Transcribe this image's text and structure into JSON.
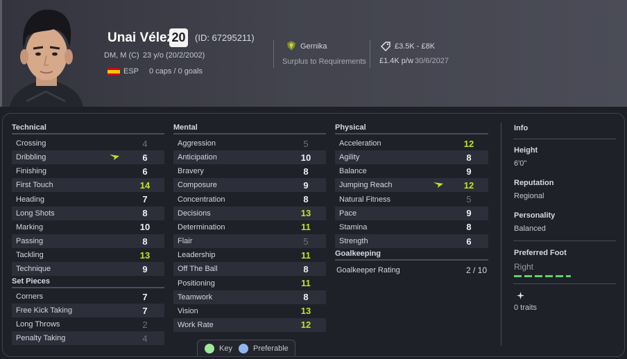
{
  "player": {
    "name": "Unai Vélez",
    "age": "20",
    "id": "(ID: 67295211)",
    "positions": "DM, M (C)",
    "age_dob": "23 y/o (20/2/2002)",
    "nation": "ESP",
    "caps": "0 caps / 0 goals"
  },
  "club": {
    "name": "Gernika",
    "status": "Surplus to Requirements"
  },
  "contract": {
    "value": "£3.5K - £8K",
    "wage": "£1.4K p/w",
    "expiry": "30/6/2027"
  },
  "sections": {
    "technical": "Technical",
    "set_pieces": "Set Pieces",
    "mental": "Mental",
    "physical": "Physical",
    "goalkeeping": "Goalkeeping"
  },
  "technical": [
    {
      "label": "Crossing",
      "value": "4"
    },
    {
      "label": "Dribbling",
      "value": "6"
    },
    {
      "label": "Finishing",
      "value": "6"
    },
    {
      "label": "First Touch",
      "value": "14"
    },
    {
      "label": "Heading",
      "value": "7"
    },
    {
      "label": "Long Shots",
      "value": "8"
    },
    {
      "label": "Marking",
      "value": "10"
    },
    {
      "label": "Passing",
      "value": "8"
    },
    {
      "label": "Tackling",
      "value": "13"
    },
    {
      "label": "Technique",
      "value": "9"
    }
  ],
  "set_pieces": [
    {
      "label": "Corners",
      "value": "7"
    },
    {
      "label": "Free Kick Taking",
      "value": "7"
    },
    {
      "label": "Long Throws",
      "value": "2"
    },
    {
      "label": "Penalty Taking",
      "value": "4"
    }
  ],
  "mental": [
    {
      "label": "Aggression",
      "value": "5"
    },
    {
      "label": "Anticipation",
      "value": "10"
    },
    {
      "label": "Bravery",
      "value": "8"
    },
    {
      "label": "Composure",
      "value": "9"
    },
    {
      "label": "Concentration",
      "value": "8"
    },
    {
      "label": "Decisions",
      "value": "13"
    },
    {
      "label": "Determination",
      "value": "11"
    },
    {
      "label": "Flair",
      "value": "5"
    },
    {
      "label": "Leadership",
      "value": "11"
    },
    {
      "label": "Off The Ball",
      "value": "8"
    },
    {
      "label": "Positioning",
      "value": "11"
    },
    {
      "label": "Teamwork",
      "value": "8"
    },
    {
      "label": "Vision",
      "value": "13"
    },
    {
      "label": "Work Rate",
      "value": "12"
    }
  ],
  "physical": [
    {
      "label": "Acceleration",
      "value": "12"
    },
    {
      "label": "Agility",
      "value": "8"
    },
    {
      "label": "Balance",
      "value": "9"
    },
    {
      "label": "Jumping Reach",
      "value": "12"
    },
    {
      "label": "Natural Fitness",
      "value": "5"
    },
    {
      "label": "Pace",
      "value": "9"
    },
    {
      "label": "Stamina",
      "value": "8"
    },
    {
      "label": "Strength",
      "value": "6"
    }
  ],
  "goalkeeping": {
    "label": "Goalkeeper Rating",
    "value": "2 / 10"
  },
  "info": {
    "title": "Info",
    "height_label": "Height",
    "height": "6'0\"",
    "reputation_label": "Reputation",
    "reputation": "Regional",
    "personality_label": "Personality",
    "personality": "Balanced",
    "foot_label": "Preferred Foot",
    "foot": "Right",
    "traits": "0 traits"
  },
  "legend": {
    "key": "Key",
    "preferable": "Preferable"
  },
  "colors": {
    "high": "#c8e028",
    "mid": "#eeeff3",
    "low": "#6f727d",
    "key": "#9ee89a",
    "preferable": "#8fb6f0"
  }
}
